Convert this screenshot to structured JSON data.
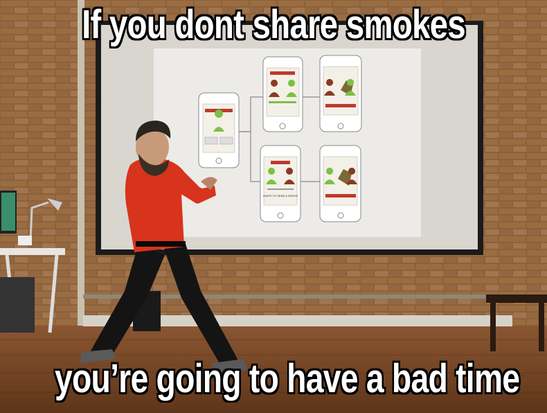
{
  "meme": {
    "top_text": "If you dont share smokes",
    "bottom_text": "you’re going to have a bad time"
  },
  "slide": {
    "phone_cta": "SWIPE TO SEND A SMOKE"
  },
  "colors": {
    "brick": "#9a6a3e",
    "floor": "#7a4a2a",
    "shirt": "#d8331c",
    "pants": "#141414",
    "screen": "#e9e9ea",
    "accent_red": "#c0392b",
    "accent_green": "#7cc143"
  }
}
